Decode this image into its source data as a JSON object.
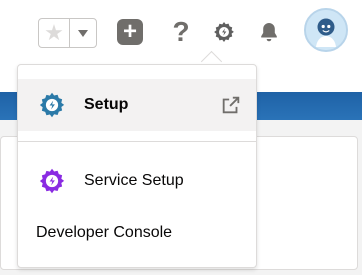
{
  "header": {
    "favorites": {
      "star_icon": "star-icon",
      "menu_icon": "chevron-down-icon"
    },
    "add_icon": "plus-icon",
    "help_label": "?",
    "setup_icon": "gear-icon",
    "notifications_icon": "bell-icon",
    "avatar_icon": "avatar-icon"
  },
  "menu": {
    "items": [
      {
        "label": "Setup",
        "icon": "gear-lightning-icon",
        "icon_color": "#2b7aa8",
        "badge": "external-link-icon"
      },
      {
        "label": "Service Setup",
        "icon": "gear-lightning-icon",
        "icon_color": "#8a2be2"
      },
      {
        "label": "Developer Console"
      }
    ]
  },
  "colors": {
    "brand_blue": "#1f62a6",
    "icon_gray": "#706e6b",
    "setup_icon_blue": "#2b7aa8",
    "service_icon_purple": "#8a2be2"
  }
}
